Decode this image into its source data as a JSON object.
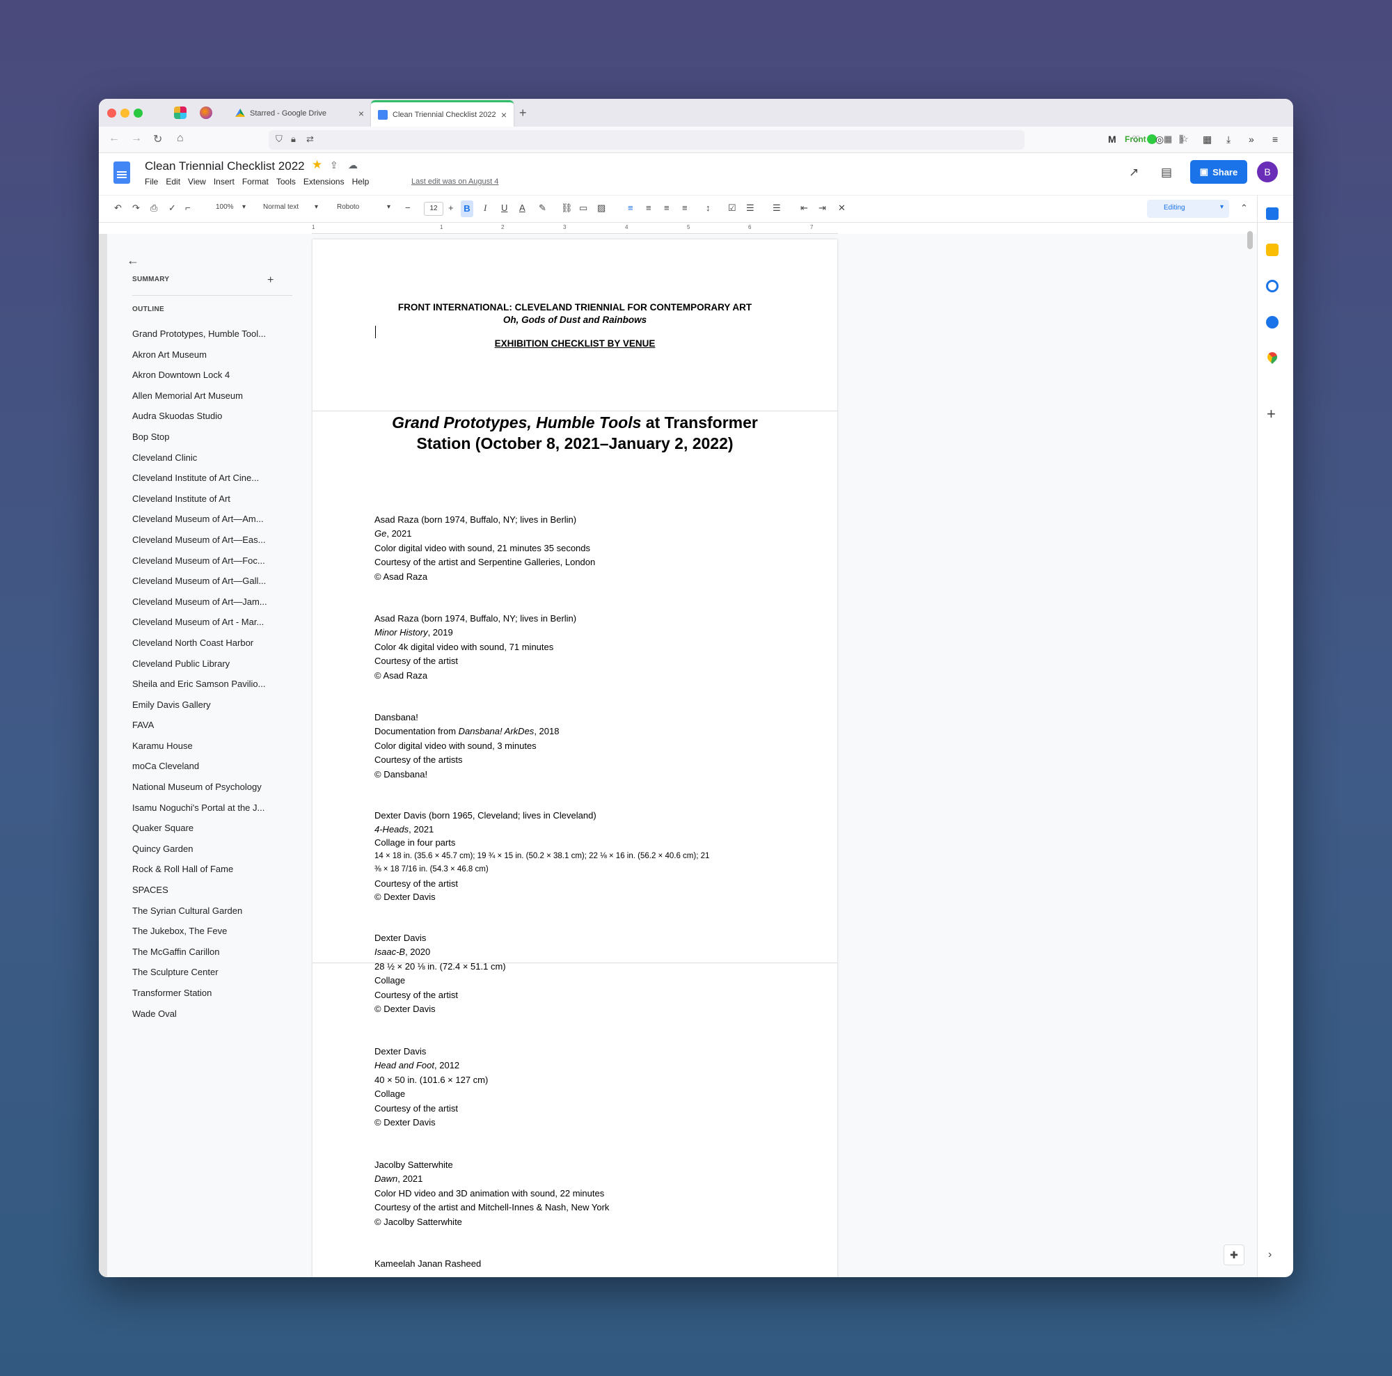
{
  "browser": {
    "tabs": [
      {
        "title": "Starred - Google Drive",
        "close": "×"
      },
      {
        "title": "Clean Triennial Checklist 2022",
        "close": "×"
      }
    ],
    "new_tab": "+",
    "front_label": "Front"
  },
  "doc": {
    "title": "Clean Triennial Checklist 2022",
    "menu": [
      "File",
      "Edit",
      "View",
      "Insert",
      "Format",
      "Tools",
      "Extensions",
      "Help"
    ],
    "last_edit": "Last edit was on August 4",
    "share_label": "Share",
    "avatar_initial": "B"
  },
  "toolbar": {
    "zoom": "100%",
    "style": "Normal text",
    "font": "Roboto",
    "font_size": "12",
    "bold": "B",
    "italic": "I",
    "underline": "U",
    "text_color": "A",
    "mode": "Editing"
  },
  "ruler": [
    "1",
    "1",
    "2",
    "3",
    "4",
    "5",
    "6",
    "7"
  ],
  "outline": {
    "summary_label": "SUMMARY",
    "outline_label": "OUTLINE",
    "items": [
      "Grand Prototypes, Humble Tool...",
      "Akron Art Museum",
      "Akron Downtown Lock 4",
      "Allen Memorial Art Museum",
      "Audra Skuodas Studio",
      "Bop Stop",
      "Cleveland Clinic",
      "Cleveland Institute of Art Cine...",
      "Cleveland Institute of Art",
      "Cleveland Museum of Art—Am...",
      "Cleveland Museum of Art—Eas...",
      "Cleveland Museum of Art—Foc...",
      "Cleveland Museum of Art—Gall...",
      "Cleveland Museum of Art—Jam...",
      "Cleveland Museum of Art - Mar...",
      "Cleveland North Coast Harbor",
      "Cleveland Public Library",
      "Sheila and Eric Samson Pavilio...",
      "Emily Davis Gallery",
      "FAVA",
      "Karamu House",
      "moCa Cleveland",
      "National Museum of Psychology",
      "Isamu Noguchi's Portal at the J...",
      "Quaker Square",
      "Quincy Garden",
      "Rock & Roll Hall of Fame",
      "SPACES",
      "The Syrian Cultural Garden",
      "The Jukebox, The Feve",
      "The McGaffin Carillon",
      "The Sculpture Center",
      "Transformer Station",
      "Wade Oval"
    ]
  },
  "content": {
    "header_line1": "FRONT INTERNATIONAL:  CLEVELAND TRIENNIAL FOR CONTEMPORARY ART",
    "header_line2": "Oh, Gods of Dust and Rainbows",
    "header_line3": "EXHIBITION CHECKLIST BY VENUE",
    "venue_title_italic": "Grand Prototypes, Humble Tools",
    "venue_title_rest1": " at Transformer",
    "venue_title_line2": "Station (October 8, 2021–January 2, 2022)",
    "e1": [
      "Asad Raza (born 1974, Buffalo, NY; lives in Berlin)",
      "Ge",
      ", 2021",
      "Color digital video with sound, 21 minutes 35 seconds",
      "Courtesy of the artist and Serpentine Galleries, London",
      "© Asad Raza"
    ],
    "e2": [
      "Asad Raza (born 1974, Buffalo, NY; lives in Berlin)",
      "Minor History",
      ", 2019",
      "Color 4k digital video with sound, 71 minutes",
      "Courtesy of the artist",
      "© Asad Raza"
    ],
    "e3": [
      "Dansbana!",
      "Documentation from ",
      "Dansbana! ArkDes",
      ", 2018",
      "Color digital video with sound, 3 minutes",
      "Courtesy of the artists",
      "© Dansbana!"
    ],
    "e4": [
      "Dexter Davis (born 1965, Cleveland; lives in Cleveland)",
      "4-Heads",
      ", 2021",
      "Collage in four parts",
      "14 × 18 in. (35.6 × 45.7 cm); 19 ¾ × 15 in. (50.2 × 38.1 cm); 22 ⅛ × 16 in. (56.2 × 40.6 cm); 21",
      "⅜ × 18 7/16 in. (54.3 × 46.8 cm)",
      "Courtesy of the artist",
      "© Dexter Davis"
    ],
    "e5": [
      "Dexter Davis",
      "Isaac-B",
      ", 2020",
      "28 ½ × 20 ⅛ in. (72.4 × 51.1 cm)",
      "Collage",
      "Courtesy of the artist",
      "© Dexter Davis"
    ],
    "e6": [
      "Dexter Davis",
      "Head and Foot",
      ", 2012",
      "40 × 50 in. (101.6 × 127 cm)",
      "Collage",
      "Courtesy of the artist",
      "© Dexter Davis"
    ],
    "e7": [
      "Jacolby Satterwhite",
      "Dawn",
      ", 2021",
      "Color HD video and 3D animation with sound, 22 minutes",
      "Courtesy of the artist and Mitchell-Innes & Nash, New York",
      "© Jacolby Satterwhite"
    ],
    "e8": [
      "Kameelah Janan Rasheed"
    ]
  }
}
